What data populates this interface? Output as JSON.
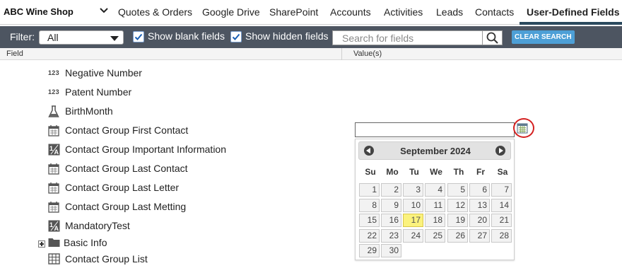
{
  "header": {
    "company": "ABC Wine Shop",
    "tabs": [
      {
        "label": "Quotes & Orders"
      },
      {
        "label": "Google Drive"
      },
      {
        "label": "SharePoint"
      },
      {
        "label": "Accounts"
      },
      {
        "label": "Activities"
      },
      {
        "label": "Leads"
      },
      {
        "label": "Contacts"
      },
      {
        "label": "User-Defined Fields",
        "active": true
      }
    ]
  },
  "filter": {
    "label": "Filter:",
    "selected": "All",
    "show_blank_label": "Show blank fields",
    "show_blank_checked": true,
    "show_hidden_label": "Show hidden fields",
    "show_hidden_checked": true,
    "search_placeholder": "Search for fields",
    "clear_label": "CLEAR SEARCH"
  },
  "columns": {
    "field": "Field",
    "values": "Value(s)"
  },
  "fields": [
    {
      "name": "Negative Number",
      "icon": "number-icon",
      "icon_text": "123"
    },
    {
      "name": "Patent Number",
      "icon": "number-icon",
      "icon_text": "123"
    },
    {
      "name": "BirthMonth",
      "icon": "flask-icon"
    },
    {
      "name": "Contact Group First Contact",
      "icon": "calendar-icon"
    },
    {
      "name": "Contact Group Important Information",
      "icon": "text-icon"
    },
    {
      "name": "Contact Group Last Contact",
      "icon": "calendar-icon"
    },
    {
      "name": "Contact Group Last Letter",
      "icon": "calendar-icon"
    },
    {
      "name": "Contact Group Last Metting",
      "icon": "calendar-icon"
    },
    {
      "name": "MandatoryTest",
      "icon": "text-icon"
    },
    {
      "name": "Basic Info",
      "icon": "folder-icon",
      "expandable": true
    },
    {
      "name": "Contact Group List",
      "icon": "grid-icon"
    }
  ],
  "date_field": {
    "value": ""
  },
  "calendar": {
    "month_label": "September 2024",
    "weekdays": [
      "Su",
      "Mo",
      "Tu",
      "We",
      "Th",
      "Fr",
      "Sa"
    ],
    "first_weekday_index": 0,
    "days_in_month": 30,
    "today": 17
  },
  "colors": {
    "filter_bar": "#4d5561",
    "accent": "#4d9fd6",
    "today_highlight": "#fbf27d",
    "annotation_circle": "#d42020",
    "active_tab_underline": "#2b4a5e"
  }
}
